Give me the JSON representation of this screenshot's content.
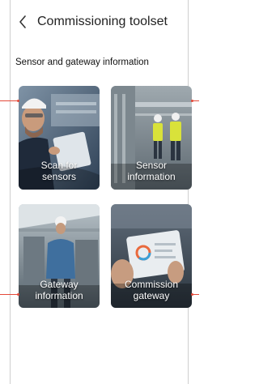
{
  "header": {
    "back_icon": "chevron-left-icon",
    "title": "Commissioning toolset"
  },
  "section": {
    "title": "Sensor and gateway information"
  },
  "tiles": [
    {
      "line1": "Scan for",
      "line2": "sensors"
    },
    {
      "line1": "Sensor",
      "line2": "information"
    },
    {
      "line1": "Gateway",
      "line2": "information"
    },
    {
      "line1": "Commission",
      "line2": "gateway"
    }
  ],
  "colors": {
    "connector": "#e44a3a",
    "tile_text": "#ffffff"
  }
}
